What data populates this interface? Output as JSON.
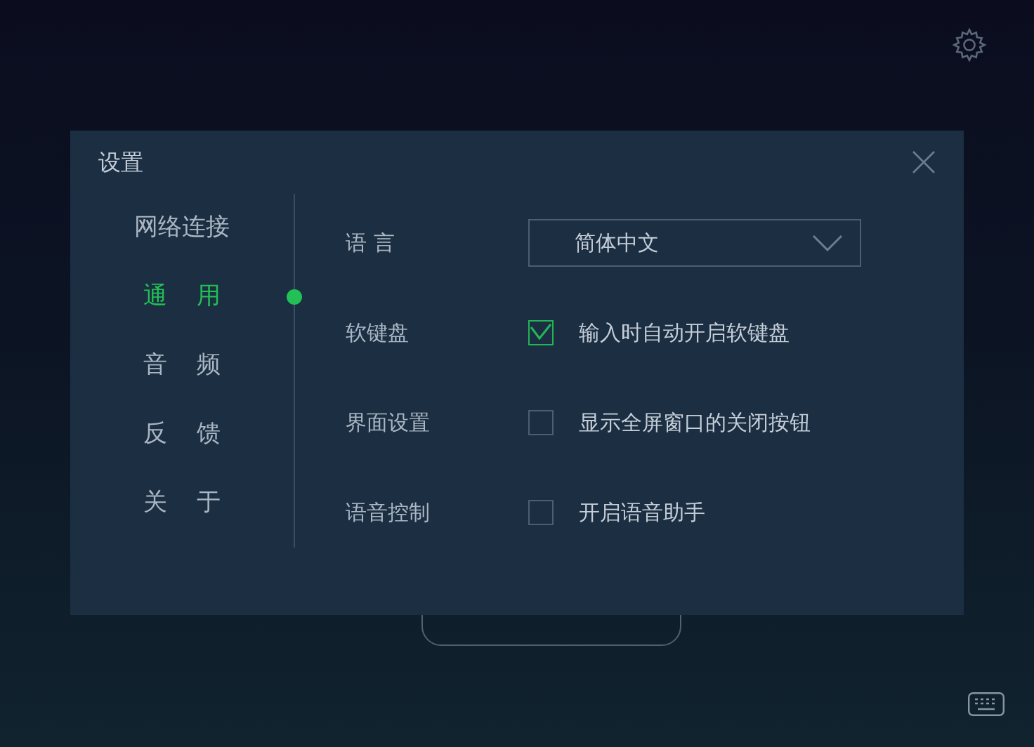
{
  "window": {
    "title": "设置"
  },
  "sidebar": {
    "items": [
      {
        "label": "网络连接",
        "selected": false
      },
      {
        "label": "通 用",
        "selected": true
      },
      {
        "label": "音 频",
        "selected": false
      },
      {
        "label": "反 馈",
        "selected": false
      },
      {
        "label": "关 于",
        "selected": false
      }
    ]
  },
  "settings": [
    {
      "kind": "dropdown",
      "label": "语 言",
      "value": "简体中文"
    },
    {
      "kind": "checkbox",
      "label": "软键盘",
      "option": "输入时自动开启软键盘",
      "checked": true
    },
    {
      "kind": "checkbox",
      "label": "界面设置",
      "option": "显示全屏窗口的关闭按钮",
      "checked": false
    },
    {
      "kind": "checkbox",
      "label": "语音控制",
      "option": "开启语音助手",
      "checked": false
    }
  ]
}
